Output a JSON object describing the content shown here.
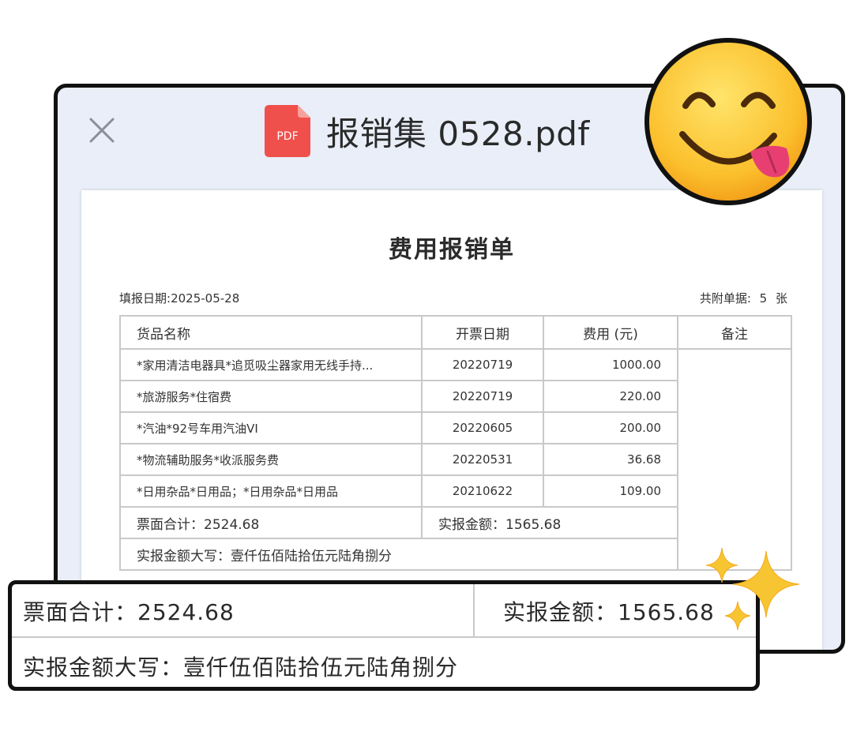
{
  "viewer": {
    "file_title": "报销集 0528.pdf",
    "pdf_icon_label": "PDF",
    "close_icon": "close-icon"
  },
  "document": {
    "title": "费用报销单",
    "fill_date_label": "填报日期:",
    "fill_date": "2025-05-28",
    "attached_label": "共附单据:",
    "attached_count": "5",
    "attached_unit": "张",
    "table": {
      "headers": [
        "货品名称",
        "开票日期",
        "费用 (元)",
        "备注"
      ],
      "rows": [
        {
          "name": "*家用清洁电器具*追觅吸尘器家用无线手持...",
          "date": "20220719",
          "amount": "1000.00"
        },
        {
          "name": "*旅游服务*住宿费",
          "date": "20220719",
          "amount": "220.00"
        },
        {
          "name": "*汽油*92号车用汽油VI",
          "date": "20220605",
          "amount": "200.00"
        },
        {
          "name": "*物流辅助服务*收派服务费",
          "date": "20220531",
          "amount": "36.68"
        },
        {
          "name": "*日用杂品*日用品；*日用杂品*日用品",
          "date": "20210622",
          "amount": "109.00"
        }
      ],
      "invoice_total": "票面合计：2524.68",
      "actual_amount": "实报金额：1565.68",
      "actual_amount_words": "实报金额大写：壹仟伍佰陆拾伍元陆角捌分"
    }
  },
  "callout": {
    "invoice_total": "票面合计：2524.68",
    "actual_amount": "实报金额：1565.68",
    "actual_amount_words": "实报金额大写：壹仟伍佰陆拾伍元陆角捌分"
  },
  "decorations": {
    "emoji": "face-savoring-food-icon",
    "sparkles": "sparkles-icon"
  },
  "colors": {
    "pdf_red": "#f0504b",
    "viewer_bg": "#e9eef8",
    "sparkle_yellow": "#f7c531"
  }
}
